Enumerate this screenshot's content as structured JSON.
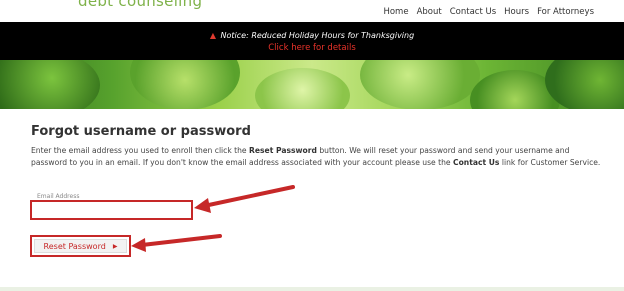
{
  "header": {
    "logo_text": "debt counseling",
    "nav": [
      "Home",
      "About",
      "Contact Us",
      "Hours",
      "For Attorneys"
    ]
  },
  "notice": {
    "message": "Notice: Reduced Holiday Hours for Thanksgiving",
    "link": "Click here for details"
  },
  "main": {
    "title": "Forgot username or password",
    "desc_intro": "Enter the email address you used to enroll then click the ",
    "desc_reset_bold": "Reset Password",
    "desc_mid": " button. We will reset your password and send your username and password to you in an email. If you don't know the email address associated with your account please use the ",
    "desc_contact_bold": "Contact Us",
    "desc_end": " link for Customer Service.",
    "email_label": "Email Address",
    "email_value": "",
    "reset_button": "Reset Password"
  },
  "colors": {
    "accent_red": "#c62828",
    "logo_green": "#7fb24a",
    "notice_bg": "#000000"
  }
}
